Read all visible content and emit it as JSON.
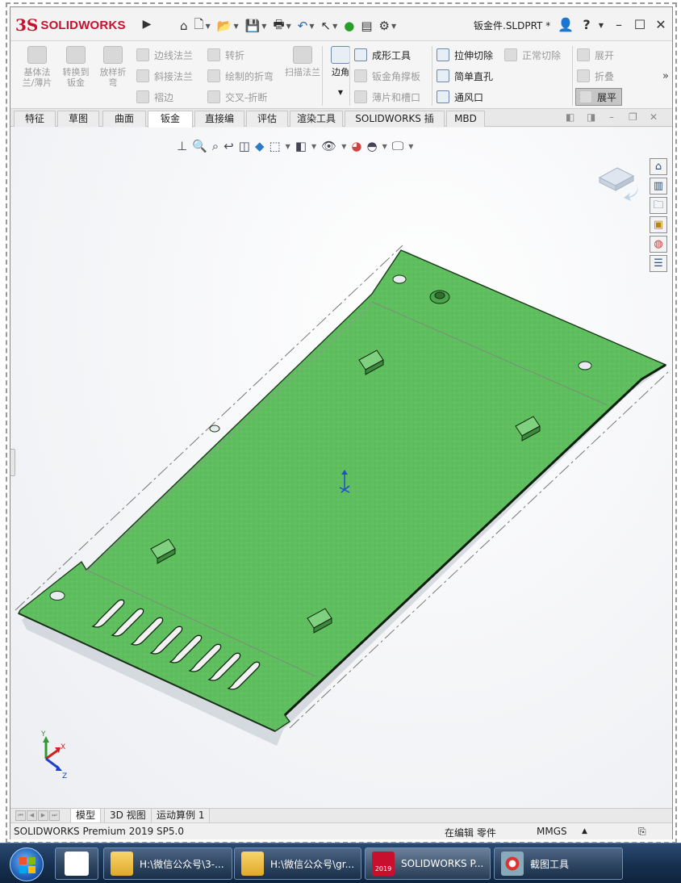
{
  "app": {
    "logo_ds": "3S",
    "logo_text": "SOLIDWORKS",
    "doc_title": "钣金件.SLDPRT *"
  },
  "ribbon": {
    "groups": [
      {
        "label": "基体法兰/薄片"
      },
      {
        "label": "转换到钣金"
      },
      {
        "label": "放样折弯"
      }
    ],
    "rows": {
      "edge_flange": "边线法兰",
      "miter_flange": "斜接法兰",
      "hem": "褶边",
      "jog": "转折",
      "sketched_bend": "绘制的折弯",
      "cross_break": "交叉-折断",
      "swept_flange": "扫描法兰",
      "corner": "边角",
      "forming_tool": "成形工具",
      "gusset": "钣金角撑板",
      "tab_slot": "薄片和槽口",
      "extruded_cut": "拉伸切除",
      "simple_hole": "简单直孔",
      "vent": "通风口",
      "normal_cut": "正常切除",
      "unfold": "展开",
      "fold": "折叠",
      "flatten": "展平"
    }
  },
  "tabs": [
    "特征",
    "草图",
    "曲面",
    "钣金",
    "直接编辑",
    "评估",
    "渲染工具",
    "SOLIDWORKS 插件",
    "MBD"
  ],
  "active_tab": "钣金",
  "bottom_tabs": [
    "模型",
    "3D 视图",
    "运动算例 1"
  ],
  "status": {
    "product": "SOLIDWORKS Premium 2019 SP5.0",
    "mode": "在编辑 零件",
    "units": "MMGS"
  },
  "triad": {
    "x": "X",
    "y": "Y",
    "z": "Z"
  },
  "taskbar": {
    "items": [
      {
        "label": "H:\\微信公众号\\3-..."
      },
      {
        "label": "H:\\微信公众号\\gr..."
      },
      {
        "label": "SOLIDWORKS P...",
        "badge": "2019"
      },
      {
        "label": "截图工具"
      }
    ]
  },
  "colors": {
    "part_green": "#5fbf5f",
    "brand_red": "#c8102e",
    "taskbar_blue": "#1b355a"
  }
}
